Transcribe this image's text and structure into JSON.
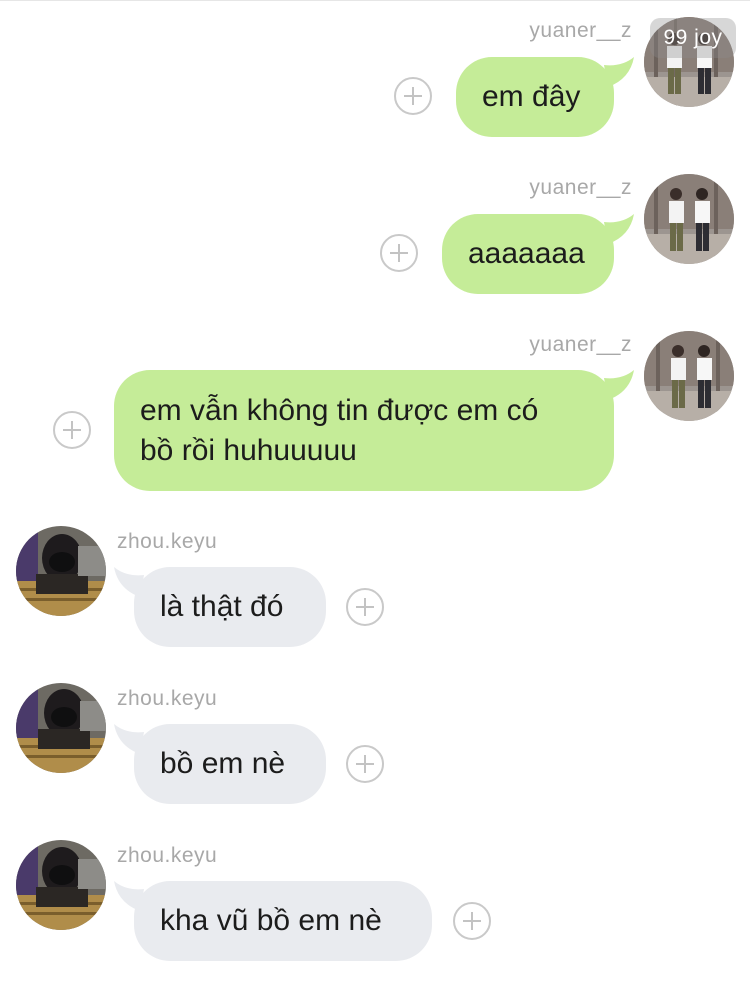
{
  "watermark": {
    "text": "99 joy"
  },
  "colors": {
    "outgoing_bubble": "#c5ec98",
    "incoming_bubble": "#e9ebef",
    "sender_name": "#a8a8a8",
    "message_text": "#1c1c1c"
  },
  "messages": [
    {
      "direction": "outgoing",
      "sender": "yuaner__z",
      "text": "em đây",
      "avatar": "dancing-boys-avatar"
    },
    {
      "direction": "outgoing",
      "sender": "yuaner__z",
      "text": "aaaaaaa",
      "avatar": "dancing-boys-avatar"
    },
    {
      "direction": "outgoing",
      "sender": "yuaner__z",
      "text": "em vẫn không tin được em có\nbồ rồi huhuuuuu",
      "avatar": "dancing-boys-avatar"
    },
    {
      "direction": "incoming",
      "sender": "zhou.keyu",
      "text": "là thật đó",
      "avatar": "masked-selfie-avatar"
    },
    {
      "direction": "incoming",
      "sender": "zhou.keyu",
      "text": "bồ em nè",
      "avatar": "masked-selfie-avatar"
    },
    {
      "direction": "incoming",
      "sender": "zhou.keyu",
      "text": "kha vũ bồ em nè",
      "avatar": "masked-selfie-avatar"
    }
  ]
}
